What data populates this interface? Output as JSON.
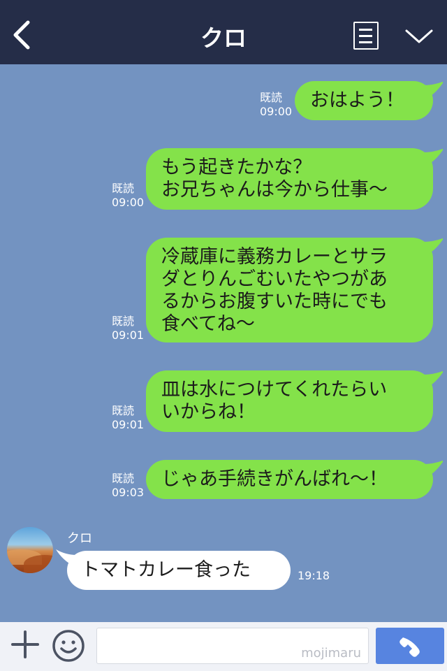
{
  "header": {
    "title": "クロ"
  },
  "messages_out": [
    {
      "read": "既読",
      "time": "09:00",
      "lines": [
        "おはよう！"
      ]
    },
    {
      "read": "既読",
      "time": "09:00",
      "lines": [
        "もう起きたかな？",
        "お兄ちゃんは今から仕事〜"
      ]
    },
    {
      "read": "既読",
      "time": "09:01",
      "lines": [
        "冷蔵庫に義務カレーとサラ",
        "ダとりんごむいたやつがあ",
        "るからお腹すいた時にでも",
        "食べてね〜"
      ]
    },
    {
      "read": "既読",
      "time": "09:01",
      "lines": [
        "皿は水につけてくれたらい",
        "いからね！"
      ]
    },
    {
      "read": "既読",
      "time": "09:03",
      "lines": [
        "じゃあ手続きがんばれ〜！"
      ]
    }
  ],
  "message_in": {
    "sender": "クロ",
    "text": "トマトカレー食った",
    "time": "19:18"
  },
  "footer": {
    "watermark": "mojimaru"
  },
  "colors": {
    "background": "#7393c1",
    "header": "#252d48",
    "outgoing_bubble": "#84e24a",
    "incoming_bubble": "#ffffff",
    "call_button": "#5784e0"
  },
  "icons": {
    "back": "chevron-left-icon",
    "menu": "menu-icon",
    "collapse": "chevron-down-icon",
    "plus": "plus-icon",
    "emoji": "smiley-icon",
    "call": "phone-icon"
  }
}
